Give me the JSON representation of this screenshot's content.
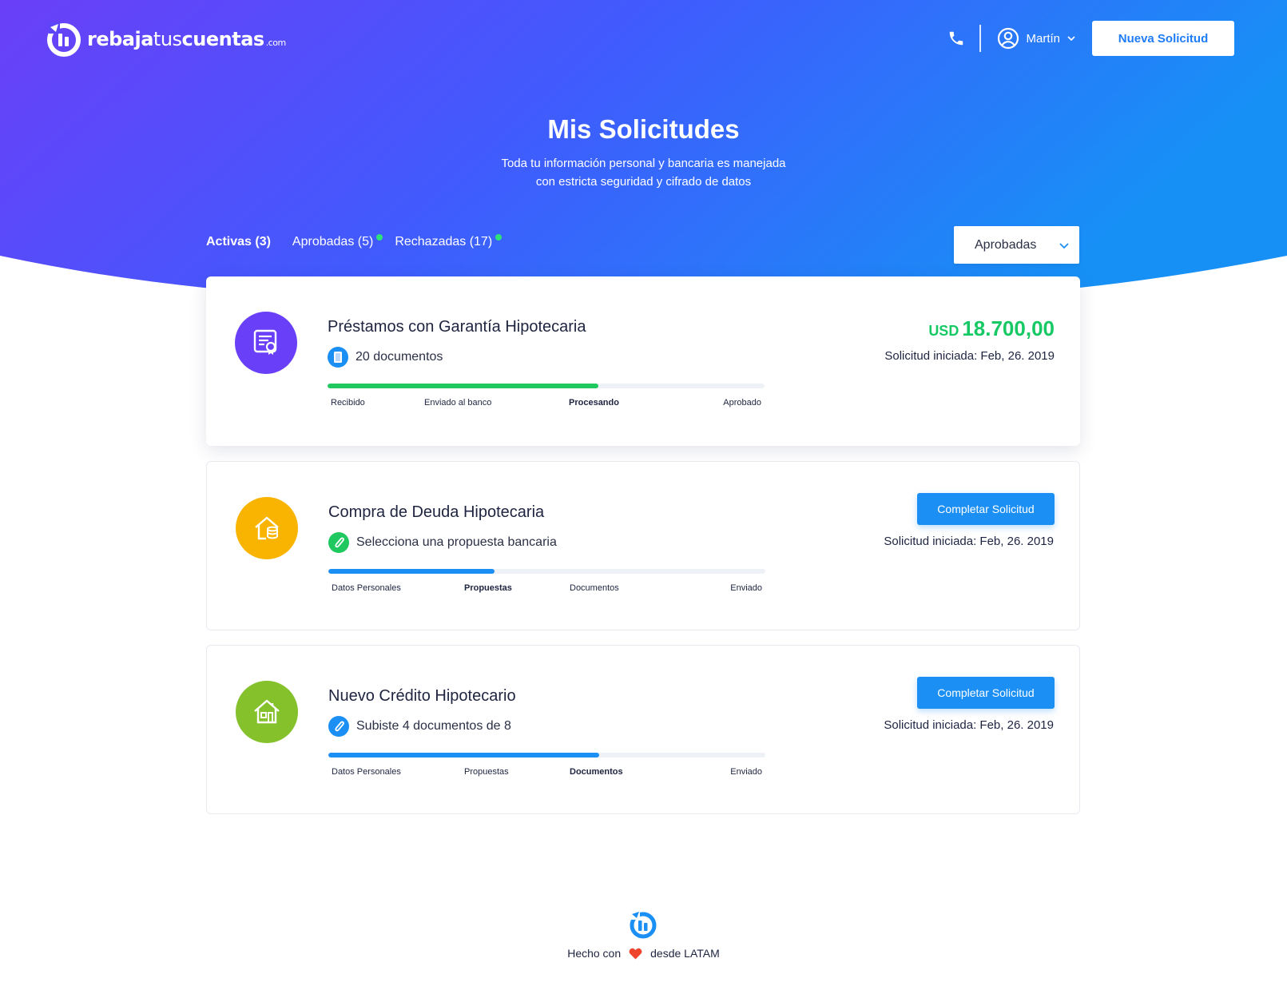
{
  "brand": {
    "name_bold": "rebaja",
    "name_light": "tus",
    "name_bold2": "cuentas",
    "name_suffix": ".com",
    "logo_icon": "logo-mark-icon"
  },
  "header": {
    "phone_icon": "phone-icon",
    "user_icon": "user-circle-icon",
    "user_name": "Martín",
    "new_request_label": "Nueva Solicitud"
  },
  "hero": {
    "title": "Mis Solicitudes",
    "subtitle_line1": "Toda tu información personal y bancaria es manejada",
    "subtitle_line2": "con estricta seguridad y cifrado de datos"
  },
  "tabs": [
    {
      "label": "Activas (3)",
      "active": true
    },
    {
      "label": "Aprobadas (5)",
      "active": false,
      "has_new": true
    },
    {
      "label": "Rechazadas (17)",
      "active": false,
      "has_new": true
    }
  ],
  "filter": {
    "selected": "Aprobadas"
  },
  "colors": {
    "gradient_start": "#6a3ff8",
    "gradient_mid": "#3f5cfd",
    "gradient_end": "#1790f6",
    "accent_blue": "#1b8ff3",
    "success_green": "#17c964",
    "progress_green": "#1fc95f",
    "progress_blue": "#1b8ff3",
    "new_dot": "#2ee27a",
    "icon_purple": "#6a3ff8",
    "icon_yellow": "#f8b400",
    "icon_green": "#84c12b",
    "heart": "#f0452d"
  },
  "cards": [
    {
      "title": "Préstamos con Garantía Hipotecaria",
      "icon": "certificate-document-icon",
      "status_icon": "document-icon",
      "status_text": "20 documentos",
      "currency": "USD",
      "amount": "18.700,00",
      "date_text": "Solicitud iniciada: Feb, 26. 2019",
      "progress_percent": 62,
      "steps": [
        "Recibido",
        "Enviado al banco",
        "Procesando",
        "Aprobado"
      ],
      "current_step": 2
    },
    {
      "title": "Compra de Deuda Hipotecaria",
      "icon": "house-coins-icon",
      "status_icon": "paperclip-icon",
      "status_text": "Selecciona una propuesta bancaria",
      "button_label": "Completar Solicitud",
      "date_text": "Solicitud iniciada: Feb, 26. 2019",
      "progress_percent": 38,
      "steps": [
        "Datos Personales",
        "Propuestas",
        "Documentos",
        "Enviado"
      ],
      "current_step": 1
    },
    {
      "title": "Nuevo Crédito Hipotecario",
      "icon": "new-house-icon",
      "status_icon": "paperclip-icon",
      "status_text": "Subiste 4 documentos de 8",
      "button_label": "Completar Solicitud",
      "date_text": "Solicitud iniciada: Feb, 26. 2019",
      "progress_percent": 62,
      "steps": [
        "Datos Personales",
        "Propuestas",
        "Documentos",
        "Enviado"
      ],
      "current_step": 2
    }
  ],
  "footer": {
    "text_before": "Hecho con",
    "text_after": "desde LATAM",
    "heart_icon": "heart-icon"
  }
}
